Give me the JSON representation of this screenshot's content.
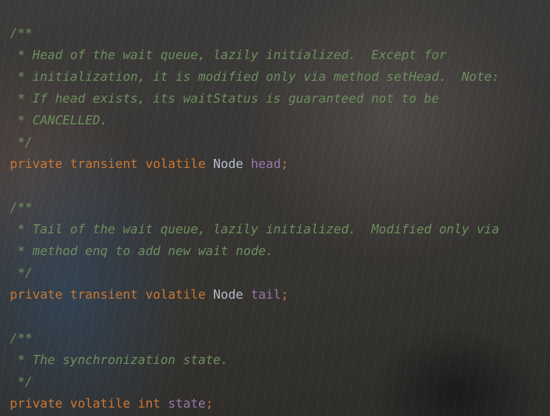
{
  "code_lines": [
    {
      "kind": "comment",
      "text": "/**"
    },
    {
      "kind": "comment",
      "text": " * Head of the wait queue, lazily initialized.  Except for"
    },
    {
      "kind": "comment",
      "text": " * initialization, it is modified only via method setHead.  Note:"
    },
    {
      "kind": "comment",
      "text": " * If head exists, its waitStatus is guaranteed not to be"
    },
    {
      "kind": "comment",
      "text": " * CANCELLED."
    },
    {
      "kind": "comment",
      "text": " */"
    },
    {
      "kind": "decl",
      "keywords": "private transient volatile ",
      "type": "Node",
      "name": "head",
      "semicolon": ";"
    },
    {
      "kind": "blank",
      "text": ""
    },
    {
      "kind": "comment",
      "text": "/**"
    },
    {
      "kind": "comment",
      "text": " * Tail of the wait queue, lazily initialized.  Modified only via"
    },
    {
      "kind": "comment",
      "text": " * method enq to add new wait node."
    },
    {
      "kind": "comment",
      "text": " */"
    },
    {
      "kind": "decl",
      "keywords": "private transient volatile ",
      "type": "Node",
      "name": "tail",
      "semicolon": ";"
    },
    {
      "kind": "blank",
      "text": ""
    },
    {
      "kind": "comment",
      "text": "/**"
    },
    {
      "kind": "comment",
      "text": " * The synchronization state."
    },
    {
      "kind": "comment",
      "text": " */"
    },
    {
      "kind": "decl",
      "keywords": "private volatile ",
      "type": "int",
      "type_color": "#cc7832",
      "name": "state",
      "semicolon": ";"
    }
  ],
  "colors": {
    "comment": "#6d8e5e",
    "keyword": "#cc7832",
    "type": "#b6bfca",
    "field": "#9876aa"
  }
}
